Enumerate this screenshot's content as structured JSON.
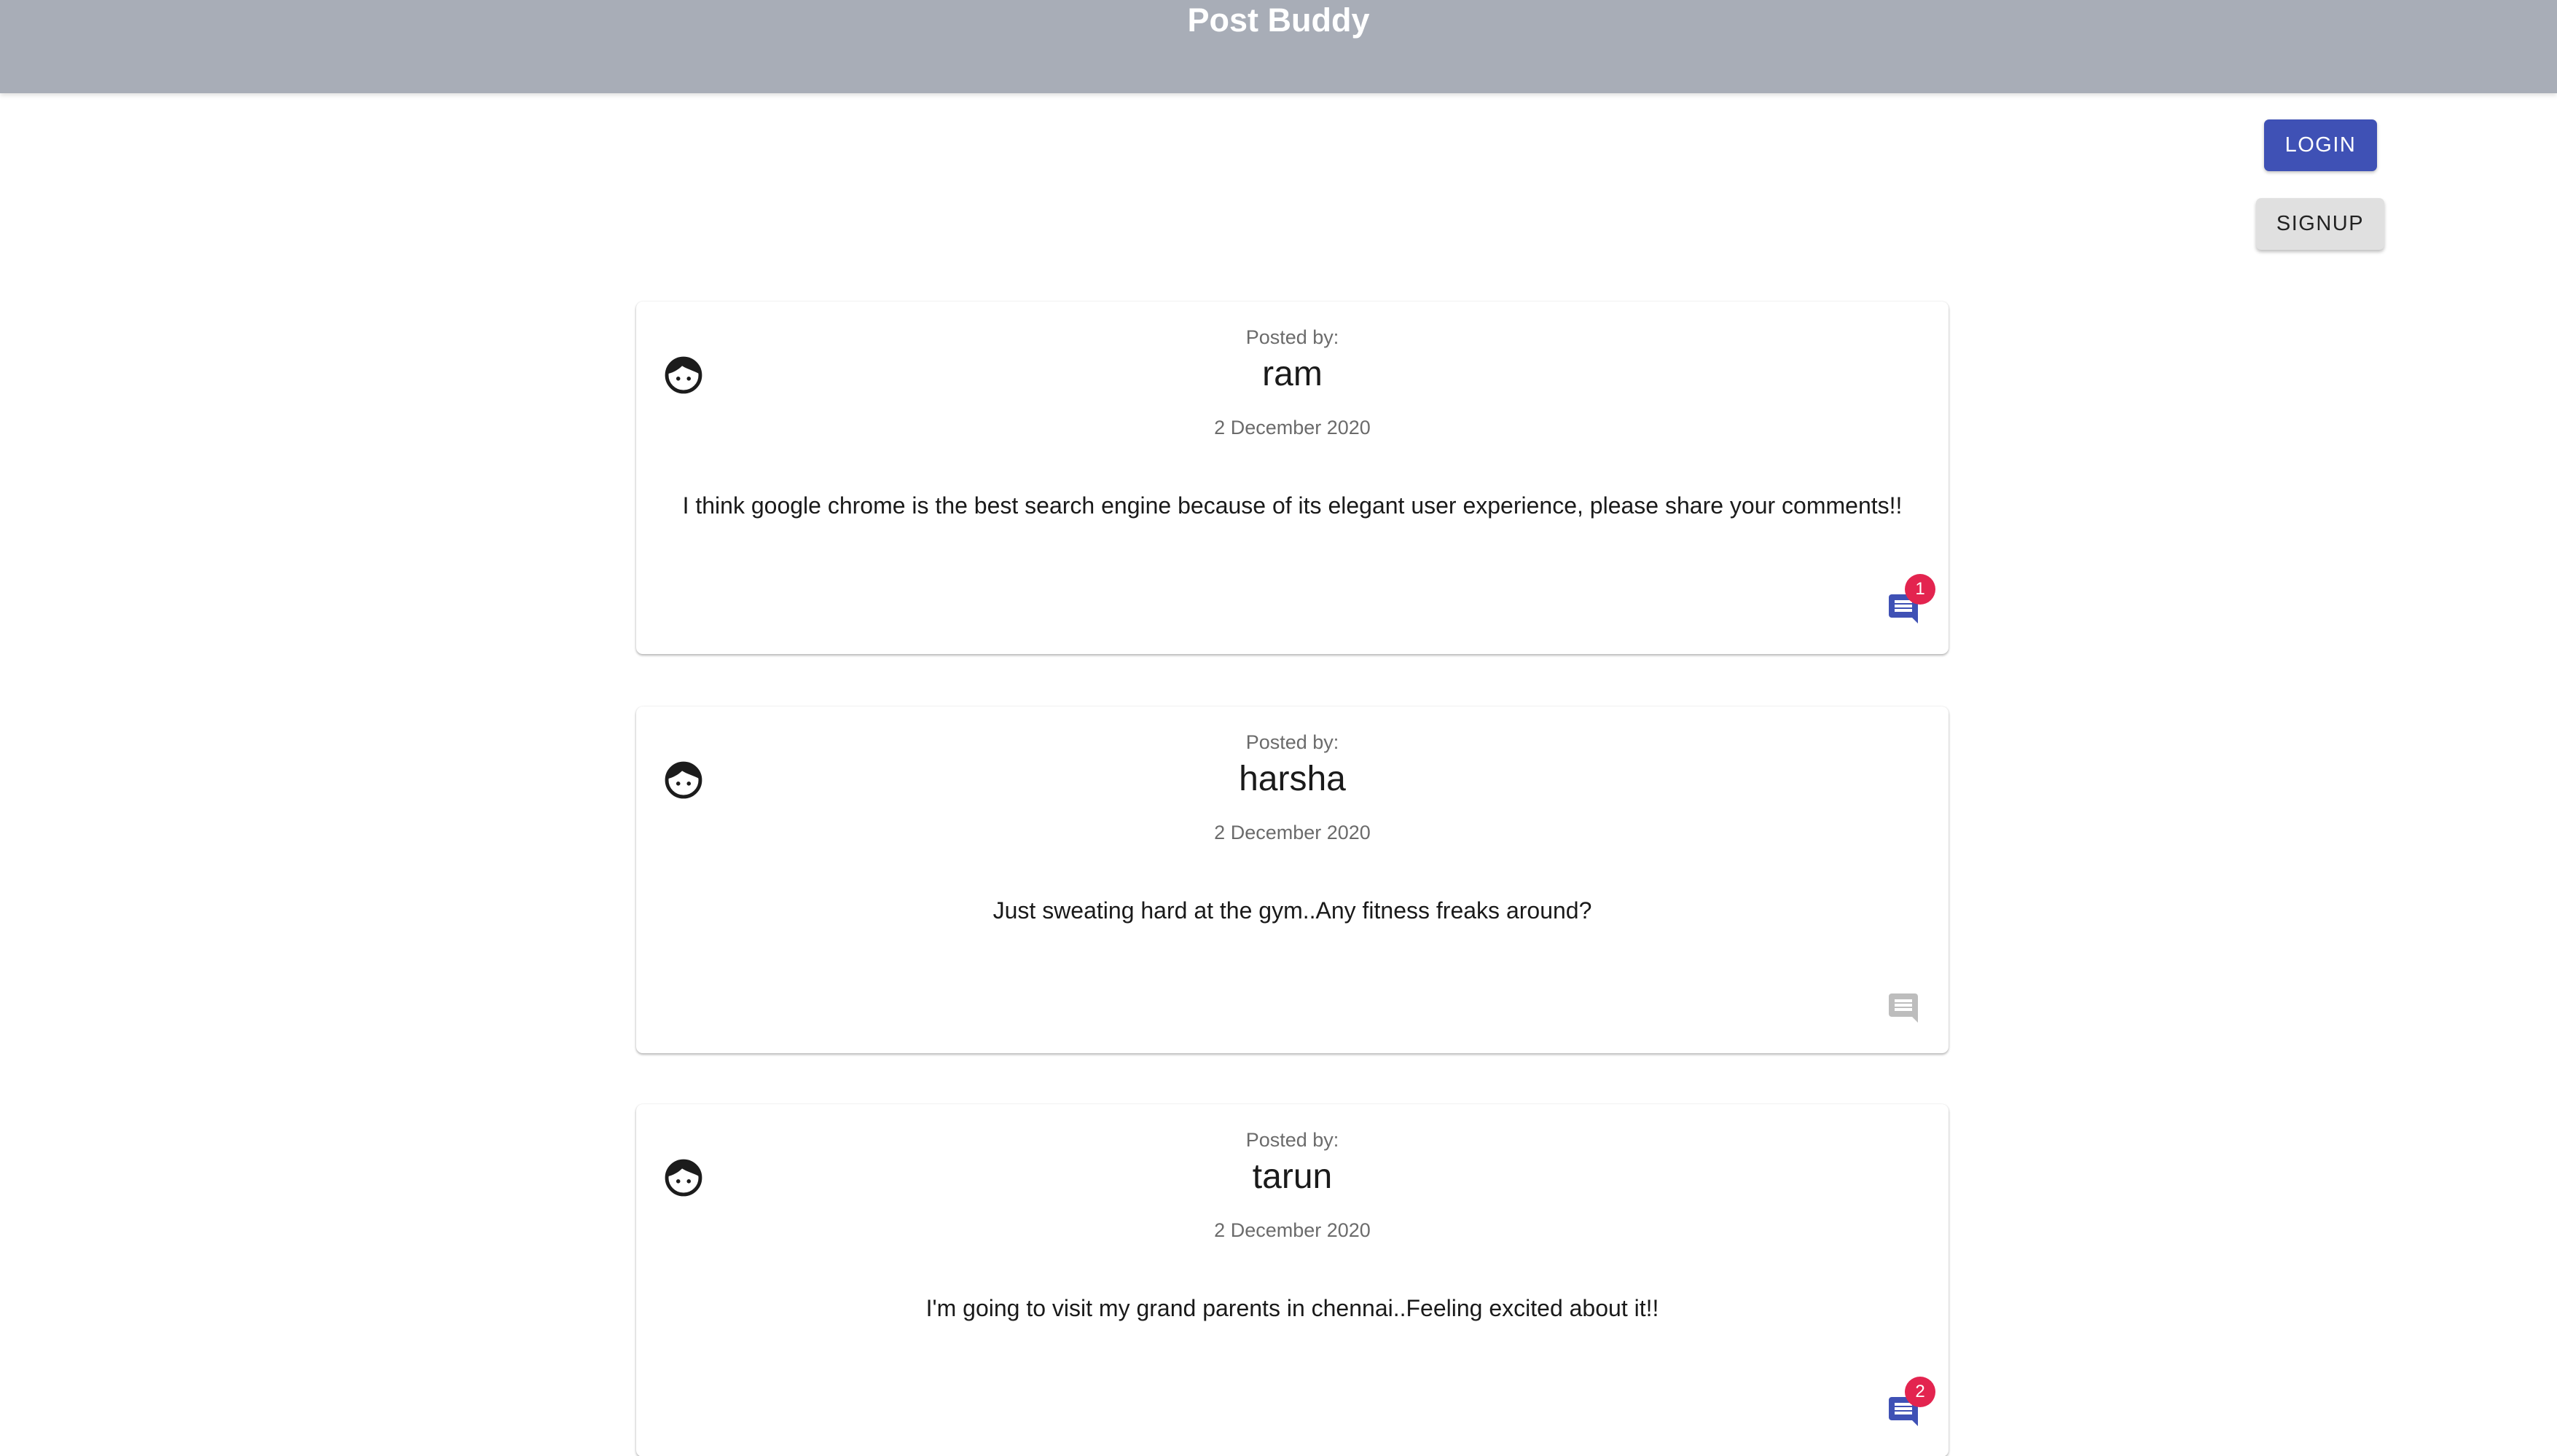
{
  "app": {
    "title": "Post Buddy"
  },
  "auth": {
    "login_label": "LOGIN",
    "signup_label": "SIGNUP"
  },
  "colors": {
    "primary": "#3f51b5",
    "app_bar": "#a8adb7",
    "badge": "#e3244f",
    "inactive_icon": "#bdbdbd"
  },
  "posts": [
    {
      "posted_by_label": "Posted by:",
      "author": "ram",
      "date": "2 December 2020",
      "content": "I think google chrome is the best search engine because of its elegant user experience, please share your comments!!",
      "comment_count": "1",
      "comment_icon": "comment-icon"
    },
    {
      "posted_by_label": "Posted by:",
      "author": "harsha",
      "date": "2 December 2020",
      "content": "Just sweating hard at the gym..Any fitness freaks around?",
      "comment_count": null,
      "comment_icon": "comment-icon"
    },
    {
      "posted_by_label": "Posted by:",
      "author": "tarun",
      "date": "2 December 2020",
      "content": "I'm going to visit my grand parents in chennai..Feeling excited about it!!",
      "comment_count": "2",
      "comment_icon": "comment-icon"
    }
  ]
}
